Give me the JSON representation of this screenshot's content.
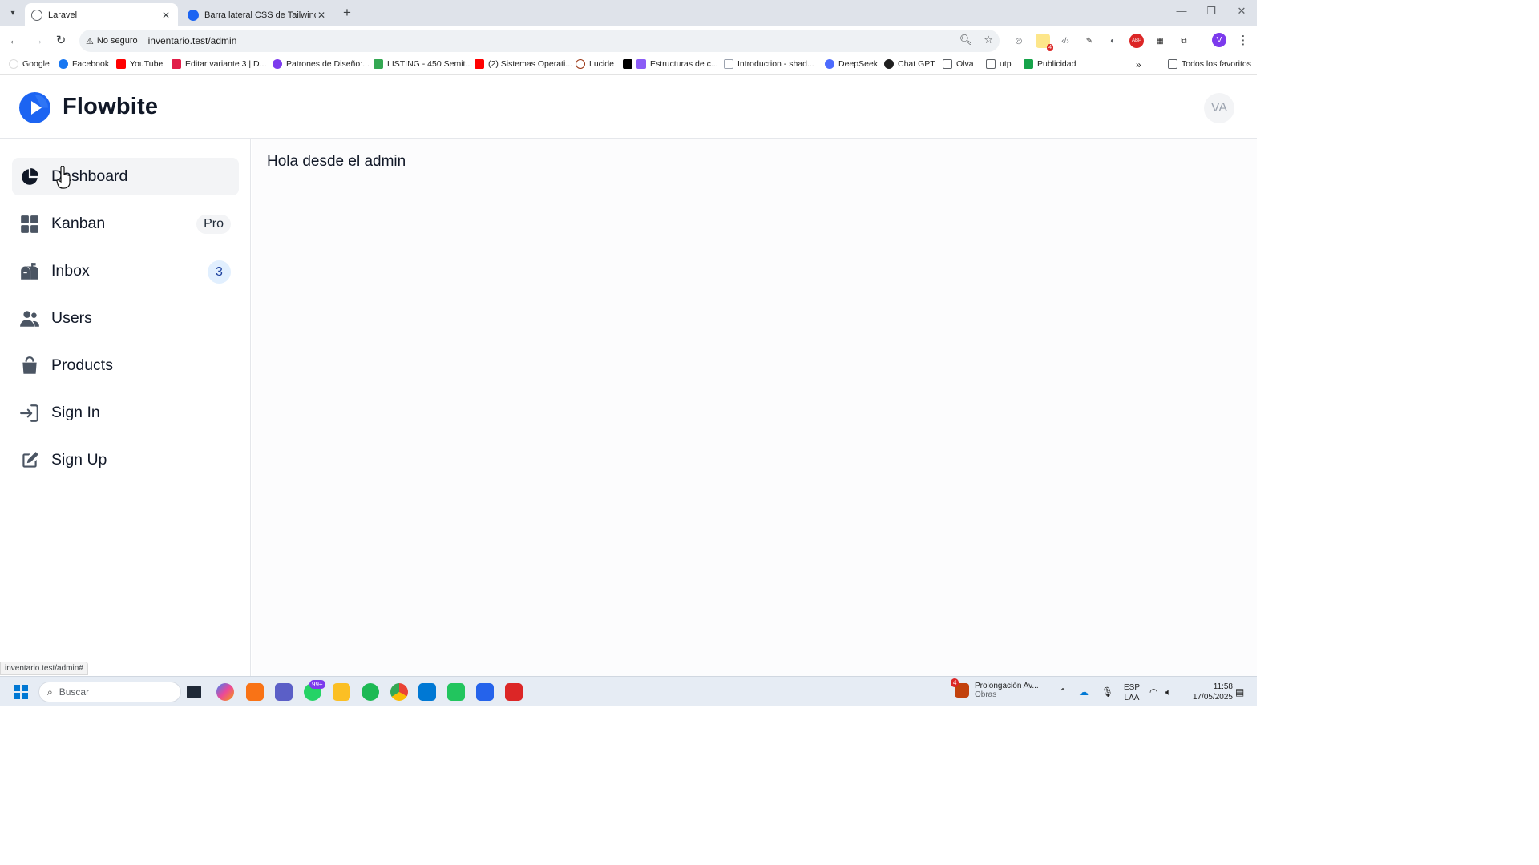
{
  "browser": {
    "tabs": [
      {
        "title": "Laravel",
        "active": true
      },
      {
        "title": "Barra lateral CSS de Tailwind - F",
        "active": false
      }
    ],
    "security_label": "No seguro",
    "url": "inventario.test/admin",
    "status_url": "inventario.test/admin#",
    "profile_initial": "V",
    "bookmarks": [
      "Google",
      "Facebook",
      "YouTube",
      "Editar variante 3 | D...",
      "Patrones de Diseño:...",
      "LISTING - 450 Semit...",
      "(2) Sistemas Operati...",
      "Lucide",
      "Estructuras de c...",
      "Introduction - shad...",
      "DeepSeek",
      "Chat GPT",
      "Olva",
      "utp",
      "Publicidad"
    ],
    "all_bookmarks_label": "Todos los favoritos",
    "extension_badge": "4"
  },
  "app": {
    "brand": "Flowbite",
    "avatar_initials": "VA",
    "sidebar": [
      {
        "label": "Dashboard",
        "icon": "chart-pie-icon"
      },
      {
        "label": "Kanban",
        "icon": "grid-icon",
        "badge": "Pro"
      },
      {
        "label": "Inbox",
        "icon": "mailbox-icon",
        "count": "3"
      },
      {
        "label": "Users",
        "icon": "users-icon"
      },
      {
        "label": "Products",
        "icon": "shopping-bag-icon"
      },
      {
        "label": "Sign In",
        "icon": "sign-in-icon"
      },
      {
        "label": "Sign Up",
        "icon": "sign-up-icon"
      }
    ],
    "main_text": "Hola desde el admin"
  },
  "taskbar": {
    "search_placeholder": "Buscar",
    "whatsapp_badge": "99+",
    "news_title": "Prolongación Av...",
    "news_subtitle": "Obras",
    "news_badge": "4",
    "language": "ESP",
    "layout": "LAA",
    "time": "11:58",
    "date": "17/05/2025"
  },
  "colors": {
    "brand_blue": "#1c64f2",
    "sidebar_hover": "#f3f4f6",
    "count_badge_bg": "#e1effe",
    "count_badge_text": "#1e429f"
  }
}
